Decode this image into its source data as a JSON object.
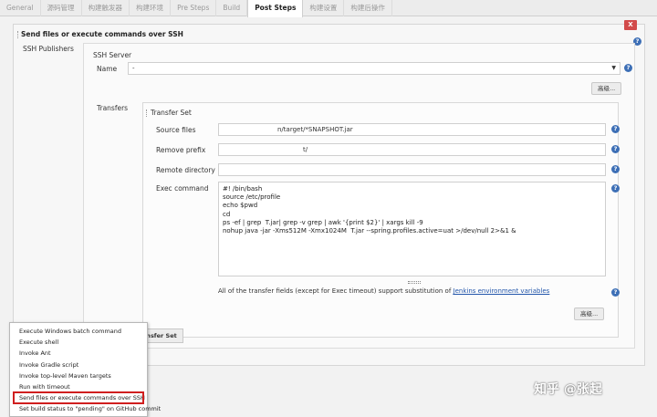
{
  "tabs": [
    "General",
    "源码管理",
    "构建触发器",
    "构建环境",
    "Pre Steps",
    "Build",
    "Post Steps",
    "构建设置",
    "构建后操作"
  ],
  "builder": {
    "title": "Send files or execute commands over SSH",
    "close_label": "X",
    "section_label": "SSH Publishers"
  },
  "ssh_server": {
    "title": "SSH Server",
    "name_label": "Name",
    "name_value": "-",
    "advanced_label": "高级..."
  },
  "transfers": {
    "label": "Transfers",
    "set_title": "Transfer Set",
    "source_files_label": "Source files",
    "source_files_value": "n/target/*SNAPSHOT.jar",
    "remove_prefix_label": "Remove prefix",
    "remove_prefix_value": "t/",
    "remote_directory_label": "Remote directory",
    "remote_directory_value": "",
    "exec_command_label": "Exec command",
    "exec_command_value": "#! /bin/bash\nsource /etc/profile\necho $pwd\ncd\nps -ef | grep  T.jar| grep -v grep | awk '{print $2}' | xargs kill -9\nnohup java -jar -Xms512M -Xmx1024M  T.jar --spring.profiles.active=uat >/dev/null 2>&1 &",
    "note_prefix": "All of the transfer fields (except for Exec timeout) support substitution of ",
    "note_link": "Jenkins environment variables",
    "advanced_label": "高级..."
  },
  "add_transfer_set_label": "Transfer Set",
  "menu": {
    "items": [
      "Execute Windows batch command",
      "Execute shell",
      "Invoke Ant",
      "Invoke Gradle script",
      "Invoke top-level Maven targets",
      "Run with timeout",
      "Send files or execute commands over SSH",
      "Set build status to \"pending\" on GitHub commit"
    ],
    "highlighted_index": 6
  },
  "watermark": "知乎 @张起",
  "help_label": "?",
  "colors": {
    "help": "#3d6fb6",
    "close": "#d24b4b",
    "highlight": "#d01f1f",
    "link": "#2255aa"
  }
}
